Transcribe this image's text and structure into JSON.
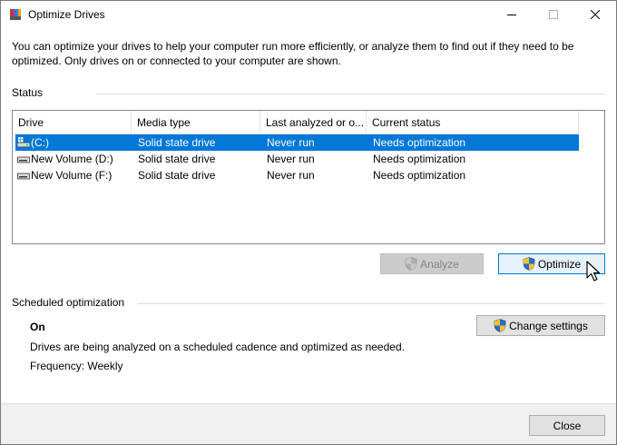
{
  "window": {
    "title": "Optimize Drives",
    "icon": "defrag-icon",
    "controls": {
      "minimize": "minimize-icon",
      "maximize": "maximize-icon",
      "close": "close-icon"
    }
  },
  "intro_text": "You can optimize your drives to help your computer run more efficiently, or analyze them to find out if they need to be optimized. Only drives on or connected to your computer are shown.",
  "status": {
    "label": "Status",
    "columns": [
      "Drive",
      "Media type",
      "Last analyzed or o...",
      "Current status"
    ],
    "rows": [
      {
        "drive": "(C:)",
        "media": "Solid state drive",
        "last": "Never run",
        "status": "Needs optimization",
        "icon": "system-drive-icon",
        "selected": true
      },
      {
        "drive": "New Volume (D:)",
        "media": "Solid state drive",
        "last": "Never run",
        "status": "Needs optimization",
        "icon": "drive-icon",
        "selected": false
      },
      {
        "drive": "New Volume (F:)",
        "media": "Solid state drive",
        "last": "Never run",
        "status": "Needs optimization",
        "icon": "drive-icon",
        "selected": false
      }
    ],
    "analyze_label": "Analyze",
    "optimize_label": "Optimize"
  },
  "scheduled": {
    "label": "Scheduled optimization",
    "state": "On",
    "change_label": "Change settings",
    "description": "Drives are being analyzed on a scheduled cadence and optimized as needed.",
    "frequency": "Frequency: Weekly"
  },
  "footer": {
    "close_label": "Close"
  },
  "colors": {
    "selection": "#0078d7",
    "button_face": "#e1e1e1",
    "default_border": "#0078d7",
    "footer_bg": "#f0f0f0"
  }
}
